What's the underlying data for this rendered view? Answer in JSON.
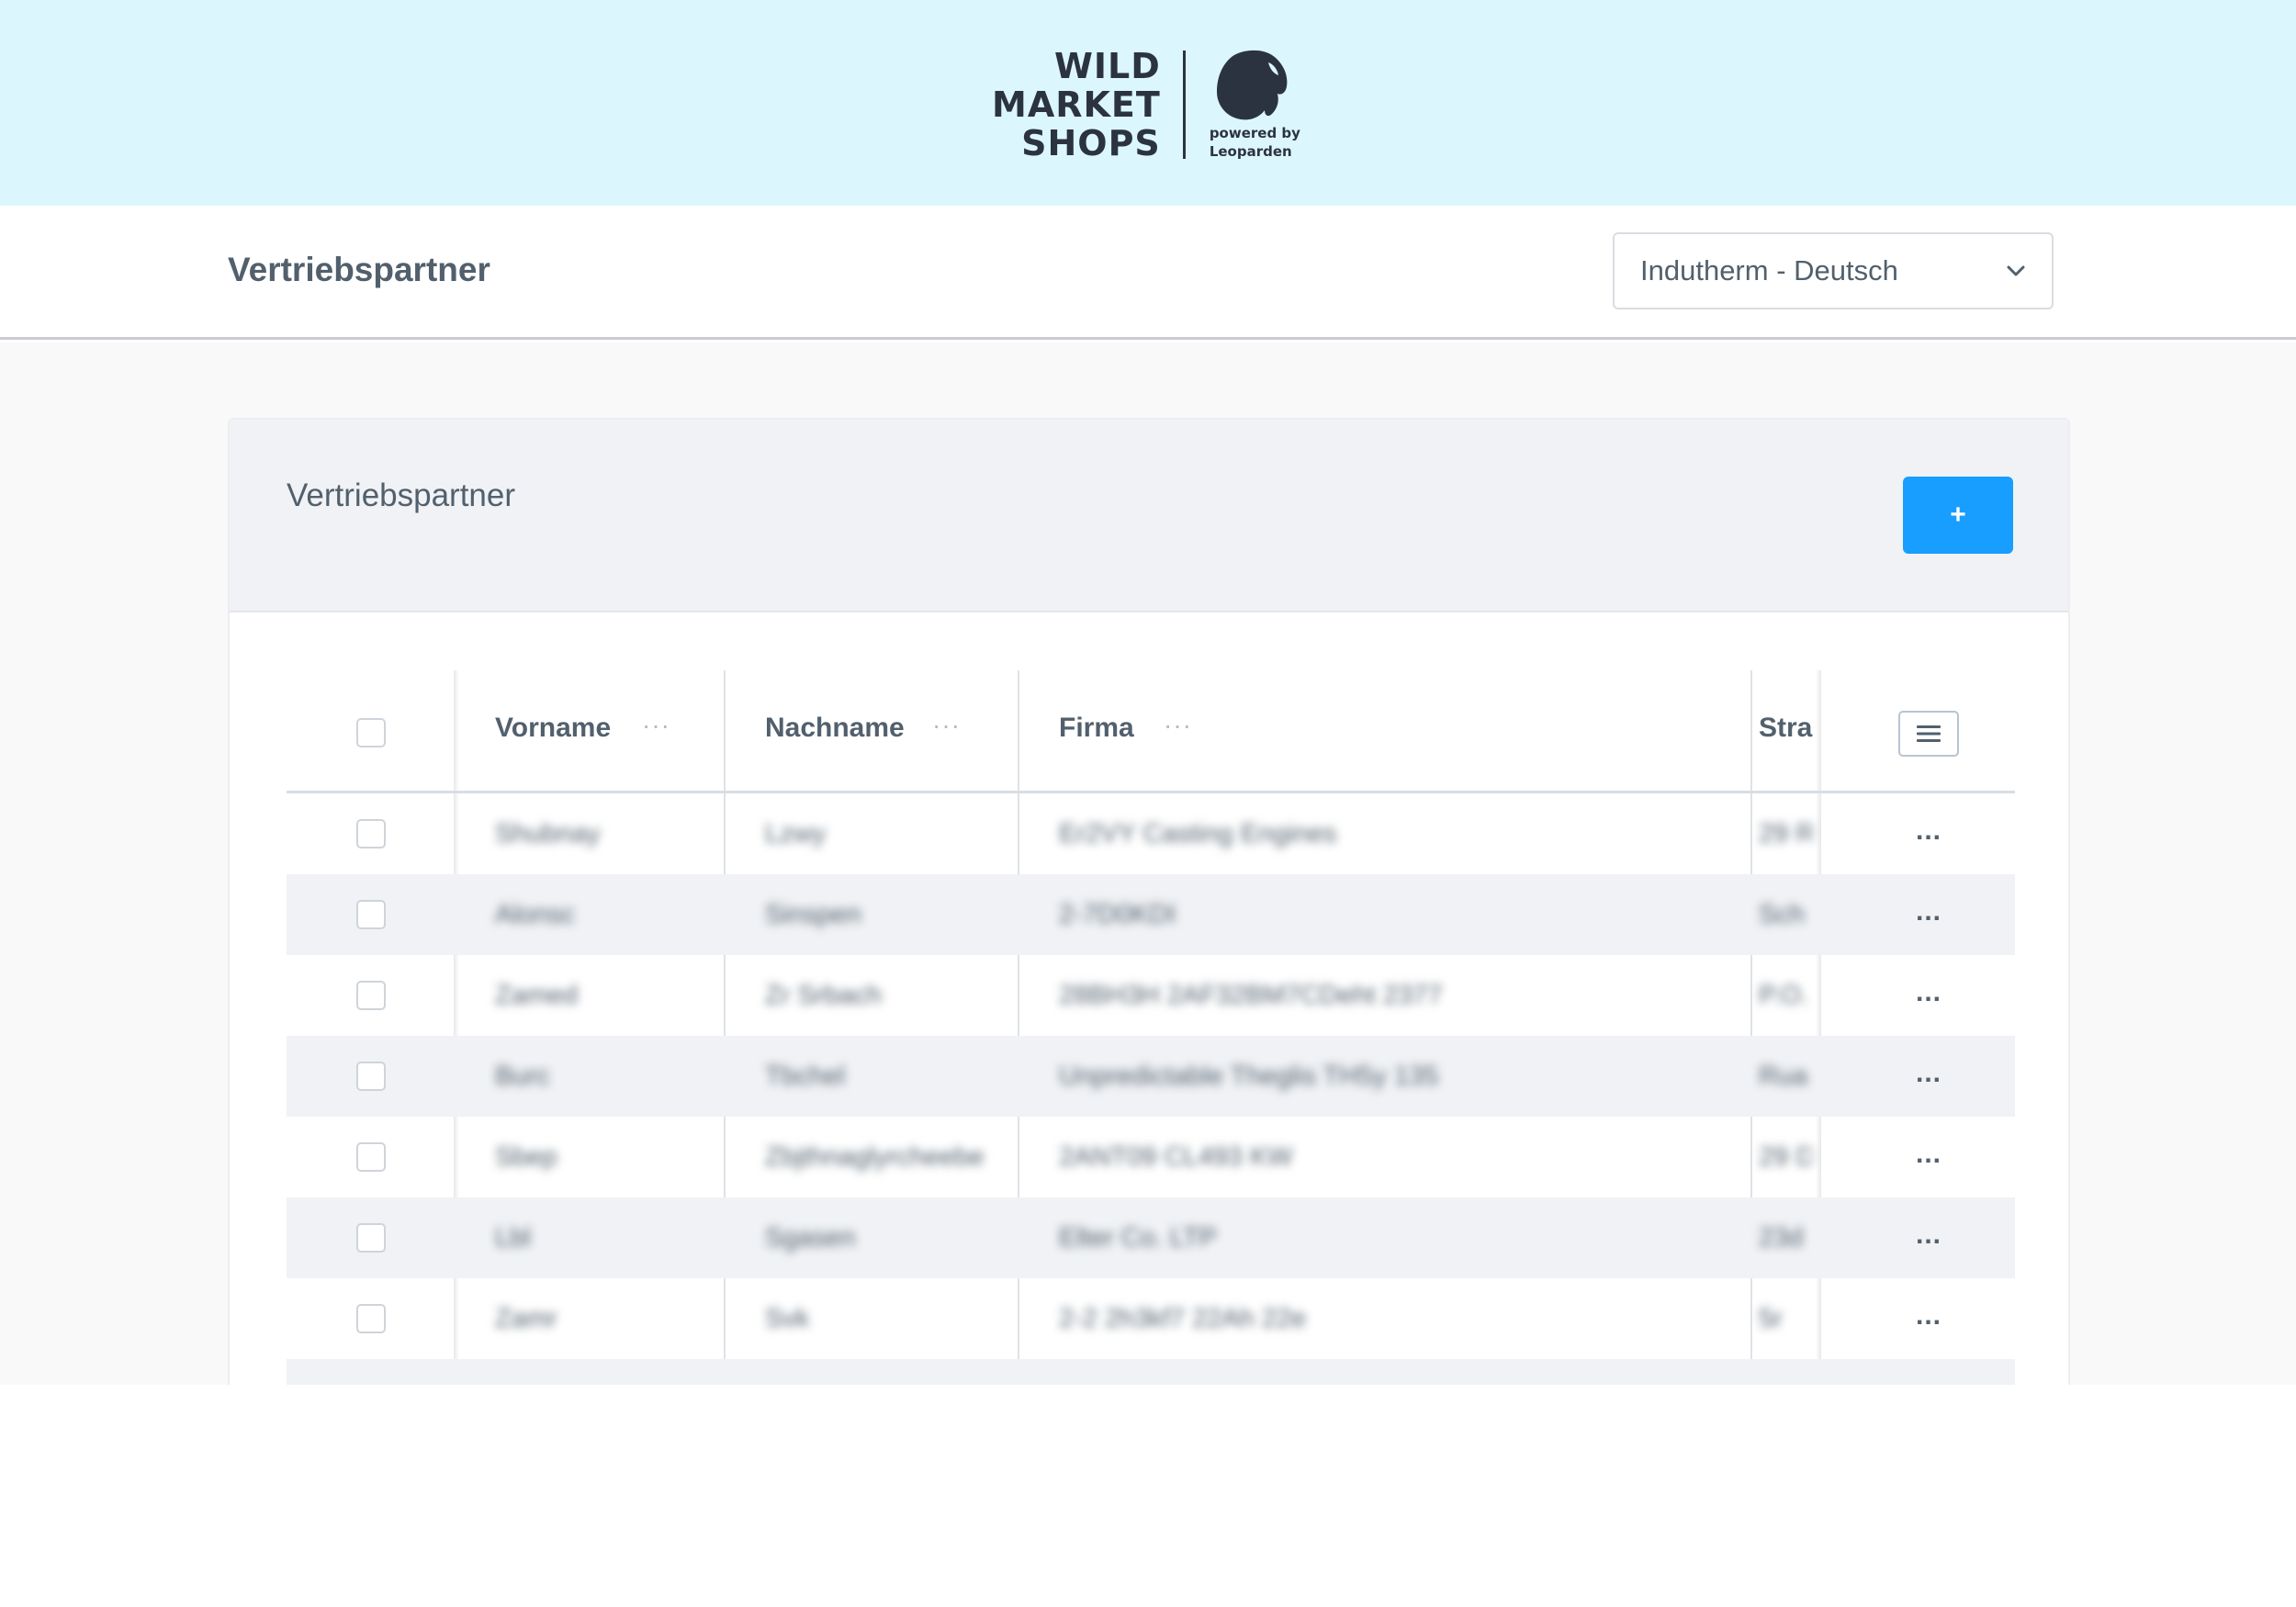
{
  "brand": {
    "logo_lines": [
      "WILD",
      "MARKET",
      "SHOPS"
    ],
    "powered_by": "powered by",
    "partner": "Leoparden",
    "icon": "leopard-head-icon",
    "banner_color": "#dbf7fd"
  },
  "header": {
    "title": "Vertriebspartner",
    "shop_select": {
      "value": "Indutherm - Deutsch",
      "icon": "chevron-down-icon"
    }
  },
  "card": {
    "title": "Vertriebspartner",
    "add_button_label": "+",
    "accent_color": "#189eff"
  },
  "grid": {
    "columns": [
      {
        "label": "Vorname"
      },
      {
        "label": "Nachname"
      },
      {
        "label": "Firma"
      },
      {
        "label": "Stra"
      }
    ],
    "column_menu_icon": "hamburger-icon",
    "row_action_label": "...",
    "rows": [
      {
        "vorname": "Shubnay",
        "nachname": "Lzwy",
        "firma": "Er2VY Casting Engines",
        "strasse": "29 R"
      },
      {
        "vorname": "Alonsc",
        "nachname": "Sinspen",
        "firma": "2-7D0KDI",
        "strasse": "Sch"
      },
      {
        "vorname": "Zamed",
        "nachname": "Zr Srbach",
        "firma": "28BH3H 2AF32BM7CDeht 2377",
        "strasse": "P.O."
      },
      {
        "vorname": "Burc",
        "nachname": "Tbchel",
        "firma": "Unpredictable Theglis TH5y 135",
        "strasse": "Rua"
      },
      {
        "vorname": "Sbep",
        "nachname": "Zbjthnaglyrcheebe",
        "firma": "2ANT09 CL493 KW",
        "strasse": "29 D"
      },
      {
        "vorname": "Lbl",
        "nachname": "Sgasen",
        "firma": "Elter Co. LTP",
        "strasse": "23d"
      },
      {
        "vorname": "Zamr",
        "nachname": "Svk",
        "firma": "2-2 2h3kf7 22Ah 22e",
        "strasse": "5r"
      }
    ]
  }
}
